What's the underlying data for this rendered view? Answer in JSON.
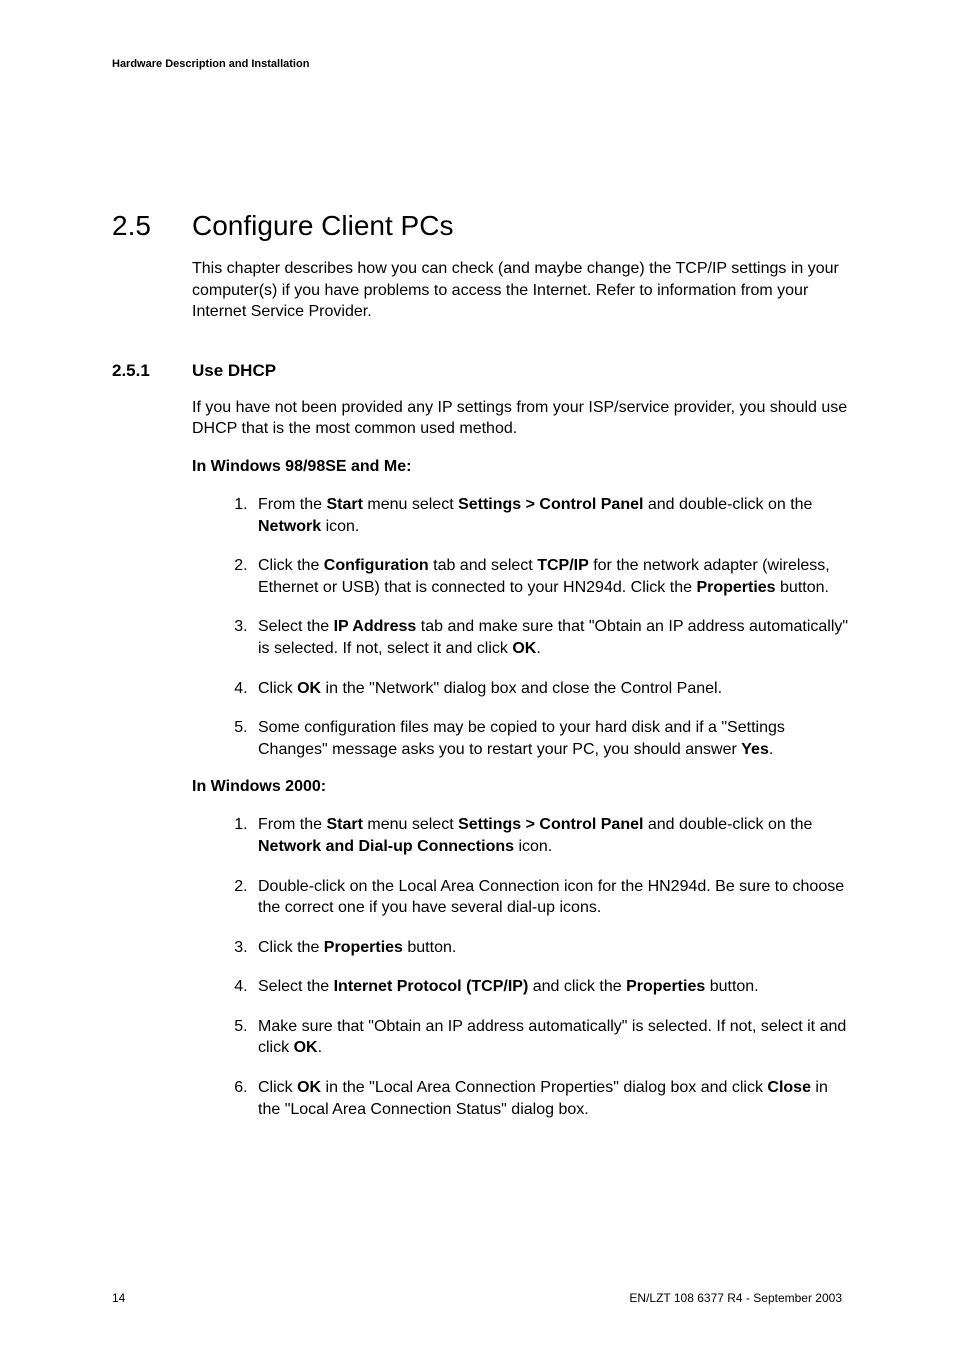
{
  "header": {
    "running_title": "Hardware Description and Installation"
  },
  "section": {
    "number": "2.5",
    "title": "Configure Client PCs",
    "intro": "This chapter describes how you can check (and maybe change) the TCP/IP settings in your computer(s) if you have problems to access the Internet. Refer to information from your Internet Service Provider."
  },
  "subsection": {
    "number": "2.5.1",
    "title": "Use DHCP",
    "intro": "If you have not been provided any IP settings from your ISP/service provider, you should use DHCP that is the most common used method."
  },
  "win98": {
    "heading": "In Windows 98/98SE and Me:",
    "steps": [
      {
        "pre": "From the ",
        "b1": "Start",
        "mid1": " menu select ",
        "b2": "Settings > Control Panel",
        "mid2": " and double-click on the ",
        "b3": "Network",
        "post": " icon."
      },
      {
        "pre": "Click the ",
        "b1": "Configuration",
        "mid1": " tab and select ",
        "b2": "TCP/IP",
        "mid2": " for the network adapter (wireless, Ethernet or USB) that is connected to your HN294d. Click the ",
        "b3": "Properties",
        "post": " button."
      },
      {
        "pre": "Select the ",
        "b1": "IP Address",
        "mid1": " tab and make sure that \"Obtain an IP address automatically\" is selected. If not, select it and click ",
        "b2": "OK",
        "post": "."
      },
      {
        "pre": "Click ",
        "b1": "OK",
        "post": " in the \"Network\" dialog box and close the Control Panel."
      },
      {
        "pre": "Some configuration files may be copied to your hard disk and if a \"Settings Changes\" message asks you to restart your PC, you should answer ",
        "b1": "Yes",
        "post": "."
      }
    ]
  },
  "win2000": {
    "heading": "In Windows 2000:",
    "steps": [
      {
        "pre": "From the ",
        "b1": "Start",
        "mid1": " menu select ",
        "b2": "Settings > Control Panel",
        "mid2": " and double-click on the ",
        "b3": "Network and Dial-up Connections",
        "post": " icon."
      },
      {
        "pre": "Double-click on the Local Area Connection icon for the HN294d. Be sure to choose the correct one if you have several dial-up icons."
      },
      {
        "pre": "Click the ",
        "b1": "Properties",
        "post": " button."
      },
      {
        "pre": "Select the ",
        "b1": "Internet Protocol (TCP/IP)",
        "mid1": " and click the ",
        "b2": "Properties",
        "post": " button."
      },
      {
        "pre": "Make sure that \"Obtain an IP address automatically\" is selected. If not, select it and click ",
        "b1": "OK",
        "post": "."
      },
      {
        "pre": "Click ",
        "b1": "OK",
        "mid1": " in the \"Local Area Connection Properties\" dialog box and click ",
        "b2": "Close",
        "post": " in the \"Local Area Connection Status\" dialog box."
      }
    ]
  },
  "footer": {
    "page": "14",
    "right": "EN/LZT 108 6377 R4 - September 2003"
  }
}
